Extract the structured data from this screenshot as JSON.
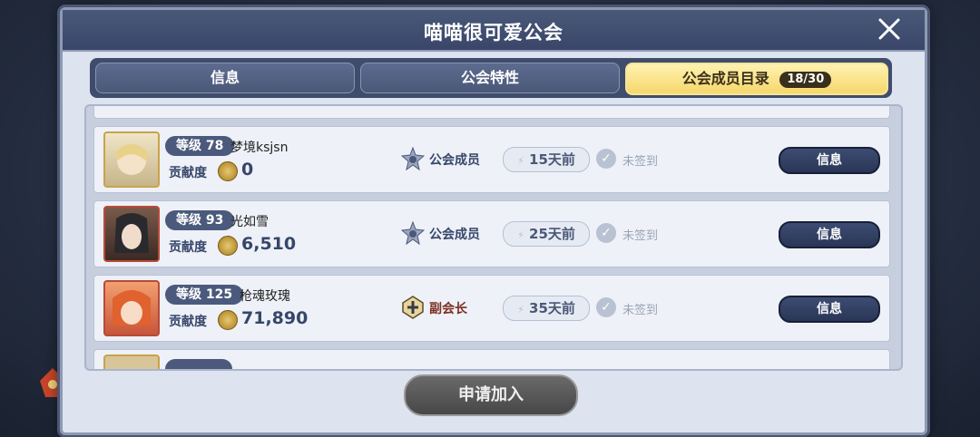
{
  "dialog": {
    "title": "喵喵很可爱公会"
  },
  "tabs": [
    {
      "label": "信息"
    },
    {
      "label": "公会特性"
    },
    {
      "label": "公会成员目录",
      "count": "18/30"
    }
  ],
  "members": [
    {
      "level": "等级 78",
      "name": "梦境ksjsn",
      "contribution_label": "贡献度",
      "contribution": "0",
      "rank": "公会成员",
      "last_online": "15天前",
      "checkin": "未签到",
      "info_label": "信息"
    },
    {
      "level": "等级 93",
      "name": "光如雪",
      "contribution_label": "贡献度",
      "contribution": "6,510",
      "rank": "公会成员",
      "last_online": "25天前",
      "checkin": "未签到",
      "info_label": "信息"
    },
    {
      "level": "等级 125",
      "name": "枪魂玫瑰",
      "contribution_label": "贡献度",
      "contribution": "71,890",
      "rank": "副会长",
      "last_online": "35天前",
      "checkin": "未签到",
      "info_label": "信息"
    }
  ],
  "join_button": "申请加入",
  "colors": {
    "active_tab": "#f5d76b",
    "vice_rank": "#7c2f22",
    "panel": "#dde3ef"
  }
}
